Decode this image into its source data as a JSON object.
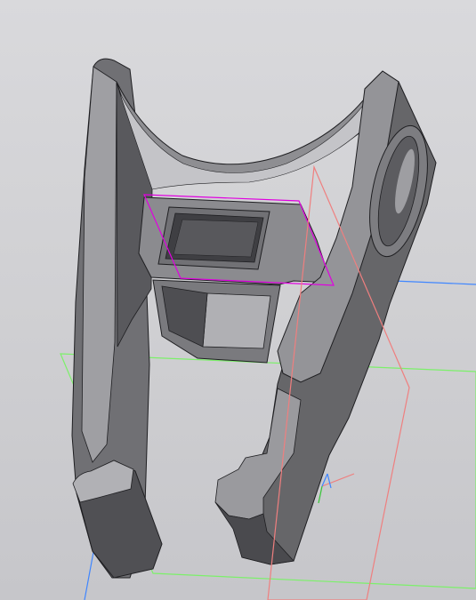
{
  "viewport": {
    "background_color": "#d3d3d6"
  },
  "model": {
    "face_dark": "#4e4e52",
    "face_mid": "#6f6f73",
    "face_light": "#a9a9ad",
    "face_highlight": "#c8c8cc",
    "edge_color": "#1f1f22"
  },
  "planes": {
    "front_plane_color": "#ef7f7f",
    "top_plane_color": "#3f86ff",
    "right_plane_color": "#7cf06a",
    "sketch_plane_color": "#e000e0"
  },
  "triad": {
    "x_axis_color": "#ef7f7f",
    "y_axis_color": "#3f86ff",
    "z_axis_color": "#35c535"
  }
}
